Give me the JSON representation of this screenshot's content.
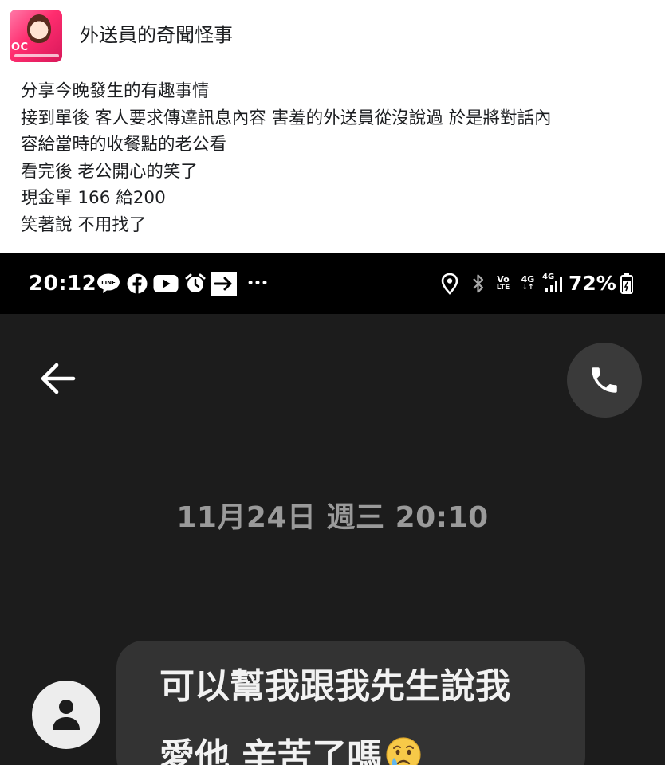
{
  "group": {
    "name": "外送員的奇聞怪事",
    "avatar_text": "OC"
  },
  "post": {
    "lines": [
      "分享今晚發生的有趣事情",
      "接到單後 客人要求傳達訊息內容 害羞的外送員從沒說過 於是將對話內",
      "容給當時的收餐點的老公看",
      "看完後 老公開心的笑了",
      "現金單 166 給200",
      "笑著說 不用找了"
    ]
  },
  "phone": {
    "status_bar": {
      "time": "20:12",
      "battery": "72%",
      "more": "•••",
      "volte_top": "Vo",
      "volte_bottom": "LTE",
      "net1": "4G",
      "net2": "4G",
      "left_icons": [
        "line-icon",
        "facebook-icon",
        "youtube-icon",
        "alarm-icon",
        "forward-arrow-icon"
      ],
      "right_icons": [
        "location-icon",
        "bluetooth-icon",
        "volte-icon",
        "network-4g-icon",
        "signal-icon",
        "battery-icon"
      ]
    },
    "chat": {
      "date_stamp": "11月24日 週三 20:10",
      "message_line1": "可以幫我跟我先生說我",
      "message_line2": "愛他 辛苦了嗎",
      "message_emoji": "crying-face"
    }
  }
}
